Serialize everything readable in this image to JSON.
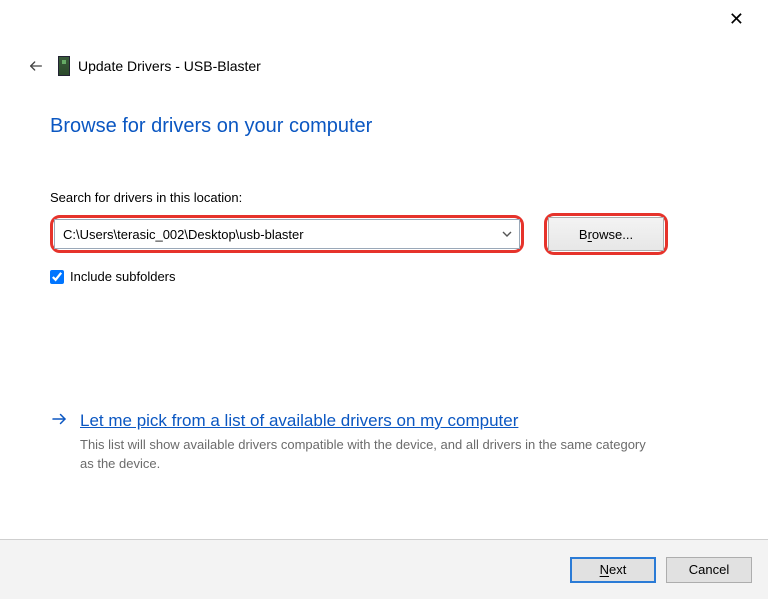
{
  "window": {
    "close_symbol": "✕"
  },
  "header": {
    "title_prefix": "Update Drivers - ",
    "title": "Update Drivers - USB-Blaster",
    "device": "USB-Blaster"
  },
  "main": {
    "heading": "Browse for drivers on your computer",
    "search_label": "Search for drivers in this location:",
    "path_value": "C:\\Users\\terasic_002\\Desktop\\usb-blaster",
    "browse_label": "Browse...",
    "browse_accesskey": "R",
    "include_subfolders_label": "Include subfolders",
    "include_subfolders_checked": true,
    "pick_link": "Let me pick from a list of available drivers on my computer",
    "pick_description": "This list will show available drivers compatible with the device, and all drivers in the same category as the device."
  },
  "footer": {
    "next_label": "Next",
    "next_accesskey": "N",
    "cancel_label": "Cancel"
  },
  "colors": {
    "accent_blue": "#0b57c2",
    "highlight_red": "#e6332b"
  }
}
